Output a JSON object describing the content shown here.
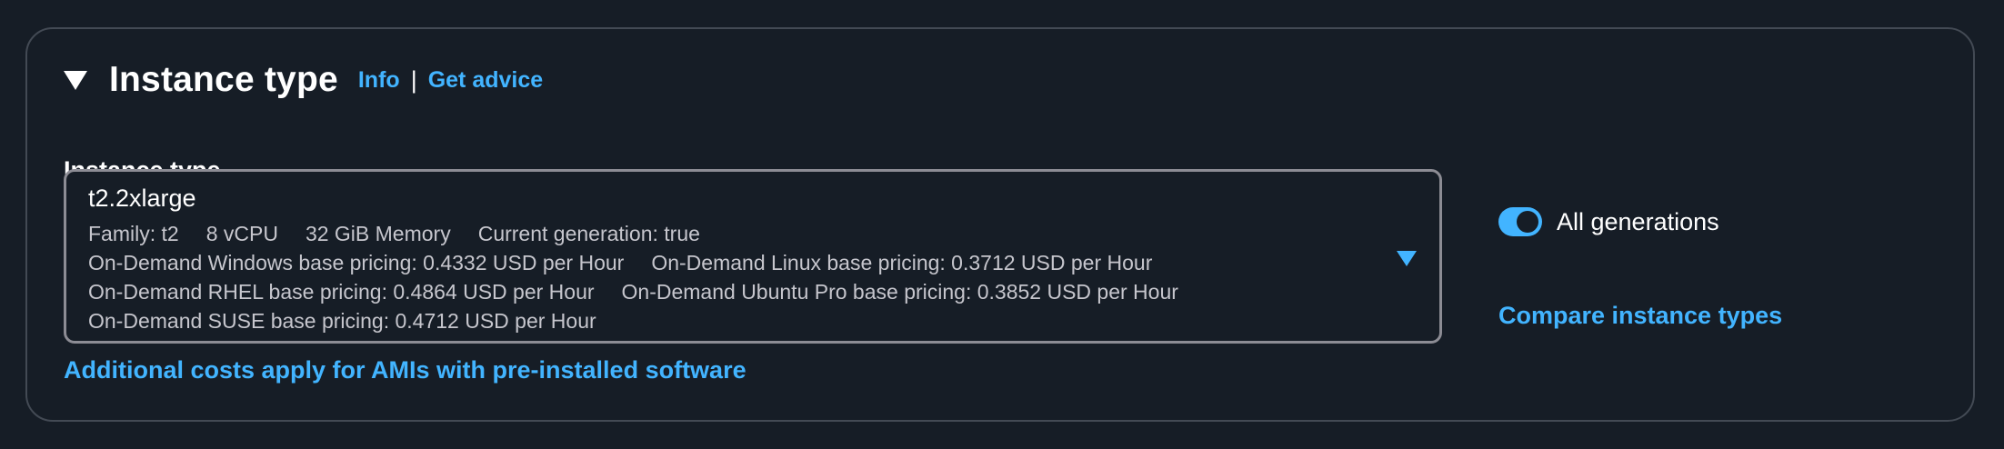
{
  "section": {
    "title": "Instance type",
    "info_label": "Info",
    "separator": "|",
    "advice_label": "Get advice"
  },
  "field": {
    "label": "Instance type",
    "selected_value": "t2.2xlarge",
    "details": {
      "family": "Family: t2",
      "vcpu": "8 vCPU",
      "memory": "32 GiB Memory",
      "generation": "Current generation: true",
      "windows_pricing": "On-Demand Windows base pricing: 0.4332 USD per Hour",
      "linux_pricing": "On-Demand Linux base pricing: 0.3712 USD per Hour",
      "rhel_pricing": "On-Demand RHEL base pricing: 0.4864 USD per Hour",
      "ubuntu_pricing": "On-Demand Ubuntu Pro base pricing: 0.3852 USD per Hour",
      "suse_pricing": "On-Demand SUSE base pricing: 0.4712 USD per Hour"
    }
  },
  "additional_costs_link": "Additional costs apply for AMIs with pre-installed software",
  "toggle": {
    "label": "All generations",
    "checked": true
  },
  "compare_link": "Compare instance types",
  "colors": {
    "background": "#161d26",
    "accent": "#42b4ff",
    "border": "#434a54",
    "field_border": "#8c8c94",
    "secondary_text": "#c6c6cd"
  },
  "icons": {
    "collapse": "caret-down-icon",
    "dropdown": "dropdown-arrow-icon"
  }
}
